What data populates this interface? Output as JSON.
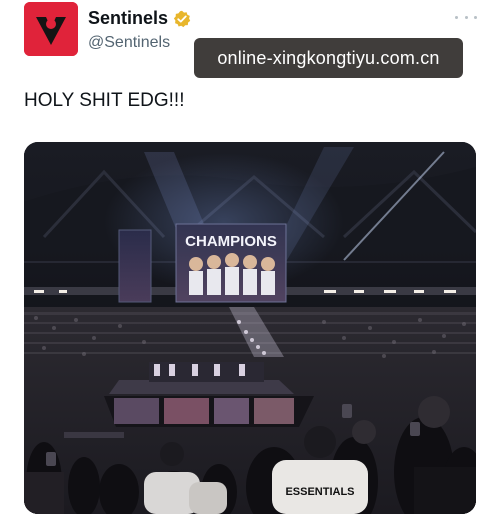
{
  "account": {
    "display_name": "Sentinels",
    "handle": "@Sentinels",
    "brand_color": "#e0233a",
    "verified_badge_color": "#e8b62c"
  },
  "icons": {
    "avatar_logo": "sentinels-logo-icon",
    "verified": "verified-badge-icon",
    "more": "more-options-icon"
  },
  "watermark": {
    "text": "online-xingkongtiyu.com.cn"
  },
  "tweet": {
    "text": "HOLY SHIT EDG!!!"
  },
  "media": {
    "screen_text": "CHAMPIONS",
    "shirt_text": "ESSENTIALS"
  }
}
